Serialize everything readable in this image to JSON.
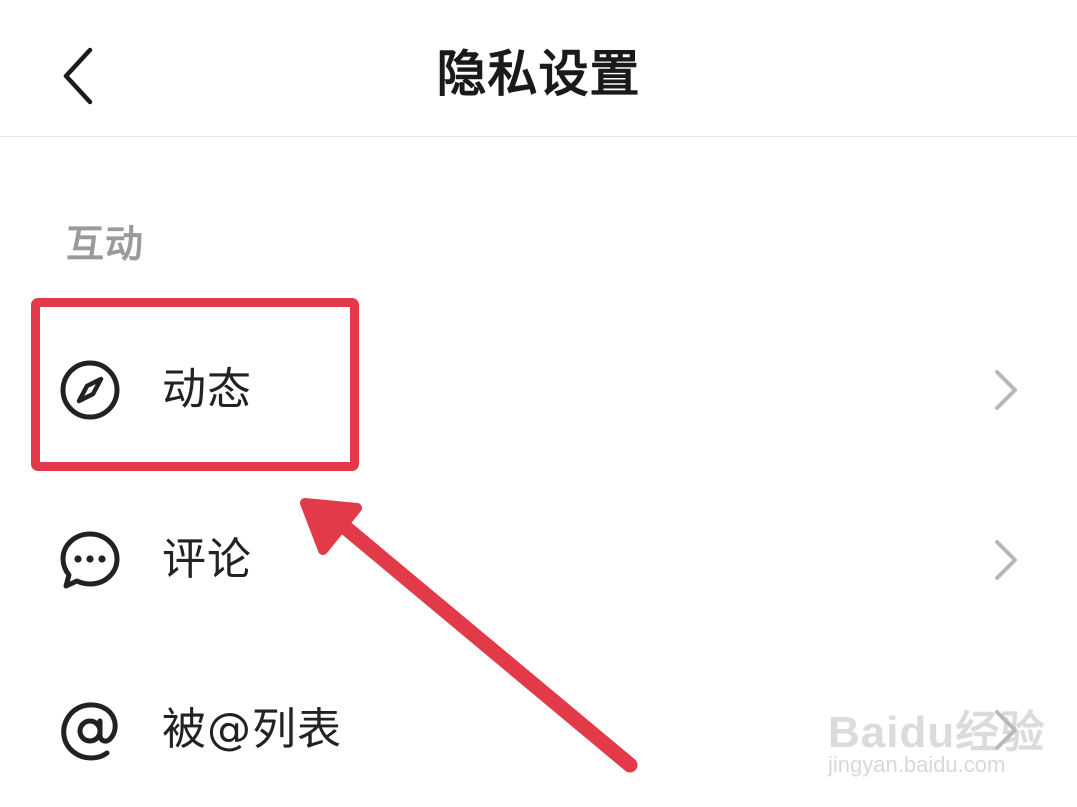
{
  "header": {
    "title": "隐私设置",
    "back_icon": "chevron-left-icon"
  },
  "section": {
    "title": "互动"
  },
  "items": [
    {
      "label": "动态",
      "icon": "compass-icon"
    },
    {
      "label": "评论",
      "icon": "chat-bubble-icon"
    },
    {
      "label": "被@列表",
      "icon": "at-sign-icon"
    }
  ],
  "annotation": {
    "color": "#e23a48",
    "highlighted_item": "动态"
  },
  "watermark": {
    "logo": "Baidu经验",
    "url": "jingyan.baidu.com"
  }
}
